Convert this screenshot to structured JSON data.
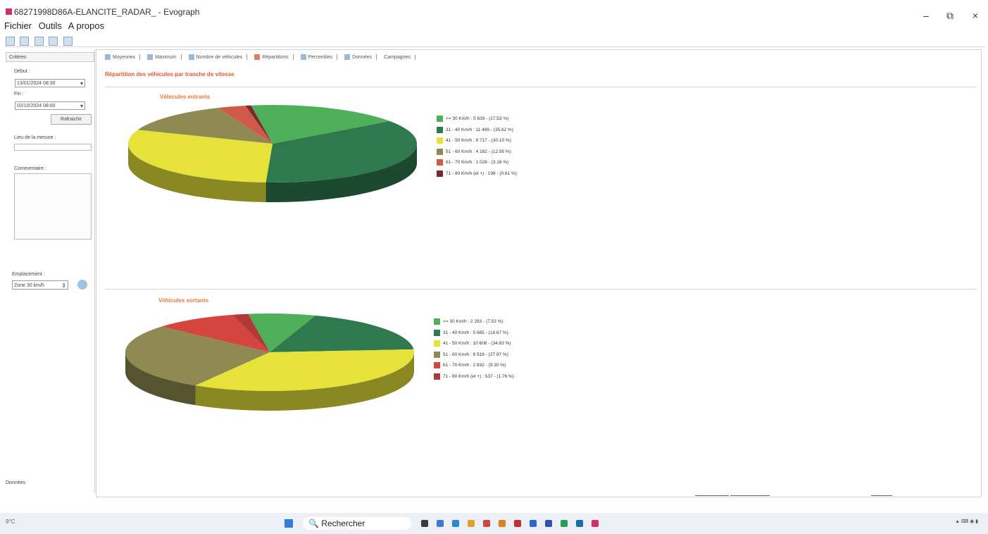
{
  "window": {
    "title": "68271998D86A-ELANCITE_RADAR_ - Evograph",
    "minimize": "–",
    "restore": "⧉",
    "close": "×"
  },
  "menu": [
    "Fichier",
    "Outils",
    "A propos"
  ],
  "left_panel": {
    "header": "Critères",
    "debut_label": "Début :",
    "debut_value": "13/01/2024 08:30",
    "fin_label": "Fin :",
    "fin_value": "02/10/2024 08:00",
    "refresh": "Rafraichir",
    "lieu_label": "Lieu de la mesure :",
    "commentaire_label": "Commentaire :",
    "emplacement_label": "Emplacement :",
    "emplacement_value": "Zone 30 km/h",
    "footer": "Données"
  },
  "tabs": [
    "Moyennes",
    "Maximum",
    "Nombre de véhicules",
    "Répartitions",
    "Percentiles",
    "Données",
    "Campagnes"
  ],
  "chart_title": "Répartition des véhicules par tranche de vitesse",
  "chart_data": [
    {
      "type": "pie",
      "title": "Véhicules entrants",
      "categories": [
        "<= 30 Km/h",
        "31 - 40 Km/h",
        "41 - 50 Km/h",
        "51 - 60 Km/h",
        "61 - 70 Km/h",
        "71 - 80 Km/h (et +)"
      ],
      "values": [
        5639,
        11499,
        9717,
        4182,
        1028,
        198
      ],
      "percents": [
        17.53,
        35.62,
        30.1,
        12.95,
        3.18,
        0.61
      ],
      "colors": [
        "#4fb05a",
        "#2e7a4e",
        "#e6e23a",
        "#8f8a52",
        "#cf5a4a",
        "#7a2a2a"
      ],
      "legend": [
        "<= 30 Km/h : 5 639 - (17.53 %)",
        "31 - 40 Km/h : 11 499 - (35.62 %)",
        "41 - 50 Km/h : 9 717 - (30.10 %)",
        "51 - 60 Km/h : 4 182 - (12.95 %)",
        "61 - 70 Km/h : 1 028 - (3.18 %)",
        "71 - 80 Km/h (et +) : 198 - (0.61 %)"
      ]
    },
    {
      "type": "pie",
      "title": "Véhicules sortants",
      "categories": [
        "<= 30 Km/h",
        "31 - 40 Km/h",
        "41 - 50 Km/h",
        "51 - 60 Km/h",
        "61 - 70 Km/h",
        "71 - 80 Km/h (et +)"
      ],
      "values": [
        2293,
        5685,
        10606,
        8518,
        2832,
        537
      ],
      "percents": [
        7.53,
        18.67,
        34.83,
        27.97,
        9.3,
        1.76
      ],
      "colors": [
        "#4fb05a",
        "#2e7a4e",
        "#e6e23a",
        "#8f8a52",
        "#d4453f",
        "#b03a3a"
      ],
      "legend": [
        "<= 30 Km/h : 2 293 - (7.53 %)",
        "31 - 40 Km/h : 5 685 - (18.67 %)",
        "41 - 50 Km/h : 10 606 - (34.83 %)",
        "51 - 60 Km/h : 8 518 - (27.97 %)",
        "61 - 70 Km/h : 2 832 - (9.30 %)",
        "71 - 80 Km/h (et +) : 537 - (1.76 %)"
      ]
    }
  ],
  "taskbar": {
    "weather": "9°C",
    "search": "Rechercher"
  }
}
